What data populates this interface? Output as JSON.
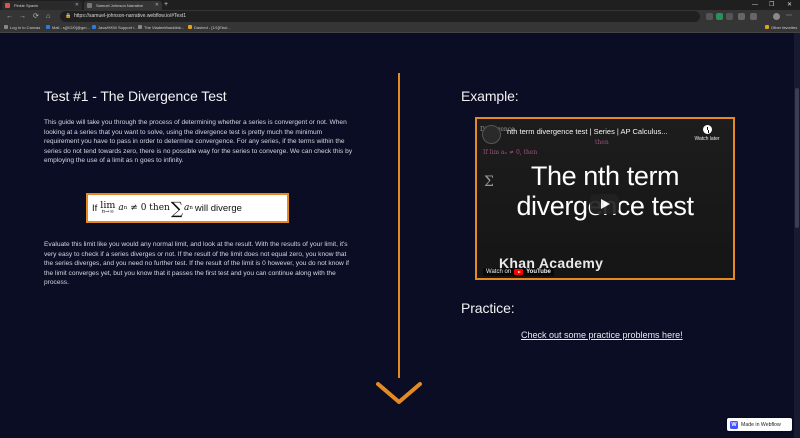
{
  "browser": {
    "tabs": [
      {
        "title": "Pinkie Spavin",
        "active": false,
        "color": "#d9534f"
      },
      {
        "title": "Samuel Johnson Narrative",
        "active": true,
        "color": "#5a5a5a"
      }
    ],
    "new_tab": "+",
    "window_controls": {
      "minimize": "—",
      "maximize": "❐",
      "close": "✕"
    },
    "nav": {
      "back": "←",
      "forward": "→",
      "reload": "⟳",
      "home": "⌂"
    },
    "url": "https://samuel-johnson-narrative.webflow.io/#Test1",
    "bookmarks": [
      "Log In to Canvas",
      "Mail - sj[0/2/0]@gm...",
      "Java/HKW Support /...",
      "The Vladeel/backlink...",
      "Dashed - [1/1]Ebol...",
      "Other favorites"
    ]
  },
  "left": {
    "heading": "Test #1 - The Divergence Test",
    "intro": "This guide will take you through the process of determining whether a series is convergent or not. When looking at a series that you want to solve, using the divergence test is pretty much the minimum requirement you have to pass in order to determine convergence. For any series, if the terms within the series do not tend towards zero, there is no possible way for the series to converge. We can check this by employing the use of a limit as n goes to infinity.",
    "formula": {
      "if": "If",
      "lim": "lim",
      "lim_sub": "n→∞",
      "a_n": "a",
      "n": "n",
      "neq": "≠ 0 then",
      "sigma": "∑",
      "a2": "a",
      "n2": "n",
      "tail": "will diverge"
    },
    "explanation": "Evaluate this limit like you would any normal limit, and look at the result. With the results of your limit, it's very easy to check if a series diverges or not. If the result of the limit does not equal zero, you know that the series diverges, and you need no further test. If the result of the limit is 0 however, you do not know if the limit converges yet, but you know that it passes the first test and you can continue along with the process."
  },
  "right": {
    "example_heading": "Example:",
    "video": {
      "title": "nth term divergence test | Series | AP Calculus...",
      "watch_later": "Watch later",
      "big_title_line1": "The nth term",
      "big_title_line2": "divergence test",
      "channel": "Khan Academy",
      "watch_on": "Watch on",
      "youtube": "YouTube",
      "scribble_1": "Divergence",
      "scribble_2": "If lim aₙ ≠ 0, then",
      "scribble_3": "then",
      "scribble_4": "Σ"
    },
    "practice_heading": "Practice:",
    "practice_link": "Check out some practice problems here!"
  },
  "badge": {
    "label": "Made in Webflow",
    "icon": "W"
  },
  "colors": {
    "accent": "#e58a22",
    "background": "#0a0d24"
  }
}
